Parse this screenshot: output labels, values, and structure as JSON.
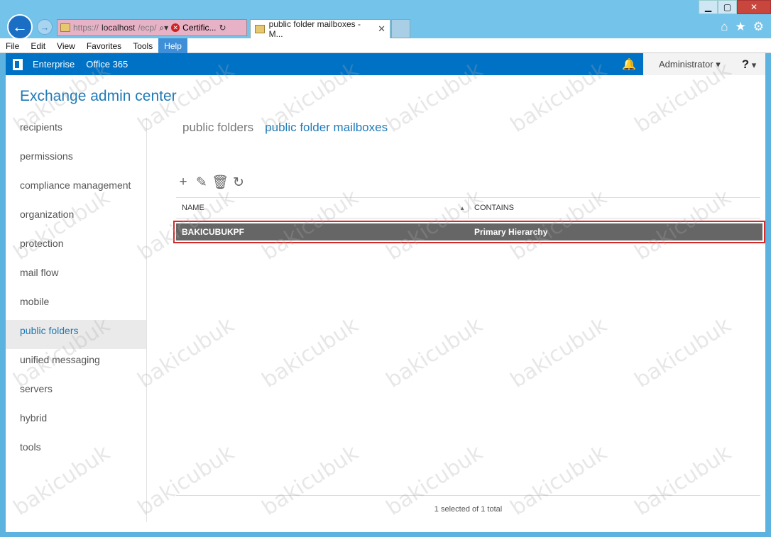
{
  "browser": {
    "address_proto": "https://",
    "address_host": "localhost",
    "address_path": "/ecp/",
    "cert_label": "Certific...",
    "tab_title": "public folder mailboxes - M..."
  },
  "menubar": [
    "File",
    "Edit",
    "View",
    "Favorites",
    "Tools",
    "Help"
  ],
  "o365": {
    "enterprise": "Enterprise",
    "office365": "Office 365",
    "account": "Administrator",
    "help": "?"
  },
  "app": {
    "title": "Exchange admin center"
  },
  "sidebar": {
    "items": [
      "recipients",
      "permissions",
      "compliance management",
      "organization",
      "protection",
      "mail flow",
      "mobile",
      "public folders",
      "unified messaging",
      "servers",
      "hybrid",
      "tools"
    ],
    "selected": "public folders"
  },
  "subnav": {
    "public_folders": "public folders",
    "public_folder_mailboxes": "public folder mailboxes"
  },
  "grid": {
    "columns": [
      "NAME",
      "CONTAINS"
    ],
    "rows": [
      {
        "name": "BAKICUBUKPF",
        "contains": "Primary Hierarchy"
      }
    ]
  },
  "footer": {
    "status": "1 selected of 1 total"
  },
  "watermark": "bakicubuk"
}
